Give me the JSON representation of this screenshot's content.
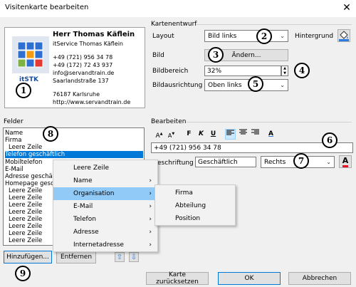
{
  "window": {
    "title": "Visitenkarte bearbeiten",
    "close_glyph": "✕"
  },
  "card": {
    "name": "Herr Thomas Käflein",
    "company": "itService Thomas Käflein",
    "phone1": "+49 (721) 956 34 78",
    "phone2": "+49 (172) 72 43 937",
    "email": "info@servandtrain.de",
    "street": "Saarlandstraße 137",
    "city": "76187  Karlsruhe",
    "web": "http://www.servandtrain.de",
    "logo_text": "itSTK"
  },
  "design": {
    "group_label": "Kartenentwurf",
    "layout_label": "Layout",
    "layout_value": "Bild links",
    "background_label": "Hintergrund",
    "image_label": "Bild",
    "change_button": "Ändern...",
    "image_area_label": "Bildbereich",
    "image_area_value": "32%",
    "image_align_label": "Bildausrichtung",
    "image_align_value": "Oben links"
  },
  "fields": {
    "group_label": "Felder",
    "items": [
      "Name",
      "Firma",
      "Leere Zeile",
      "Telefon geschäftlich",
      "Mobiltelefon",
      "E-Mail",
      "Adresse geschäf",
      "Homepage gesch",
      "Leere Zeile",
      "Leere Zeile",
      "Leere Zeile",
      "Leere Zeile",
      "Leere Zeile",
      "Leere Zeile",
      "Leere Zeile",
      "Leere Zeile"
    ],
    "selected_index": 3,
    "add_button": "Hinzufügen...",
    "remove_button": "Entfernen",
    "up_glyph": "⇧",
    "down_glyph": "⇩"
  },
  "edit": {
    "group_label": "Bearbeiten",
    "font_grow": "A",
    "font_shrink": "A",
    "bold": "F",
    "italic": "K",
    "underline": "U",
    "font_color": "A",
    "value": "+49 (721) 956 34 78",
    "caption_label": "eschriftung",
    "caption_value": "Geschäftlich",
    "caption_pos_value": "Rechts"
  },
  "context_menu": {
    "items": [
      {
        "label": "Leere Zeile",
        "submenu": false
      },
      {
        "label": "Name",
        "submenu": true
      },
      {
        "label": "Organisation",
        "submenu": true
      },
      {
        "label": "E-Mail",
        "submenu": true
      },
      {
        "label": "Telefon",
        "submenu": true
      },
      {
        "label": "Adresse",
        "submenu": true
      },
      {
        "label": "Internetadresse",
        "submenu": true
      }
    ],
    "highlighted_index": 2,
    "submenu_items": [
      "Firma",
      "Abteilung",
      "Position"
    ]
  },
  "footer": {
    "reset_button": "Karte zurücksetzen",
    "ok_button": "OK",
    "cancel_button": "Abbrechen"
  },
  "markers": [
    "1",
    "2",
    "3",
    "4",
    "5",
    "6",
    "7",
    "8",
    "9"
  ],
  "colors": {
    "selection": "#0078d7",
    "menu_highlight": "#91c9f7",
    "accent_red": "#e81123"
  }
}
